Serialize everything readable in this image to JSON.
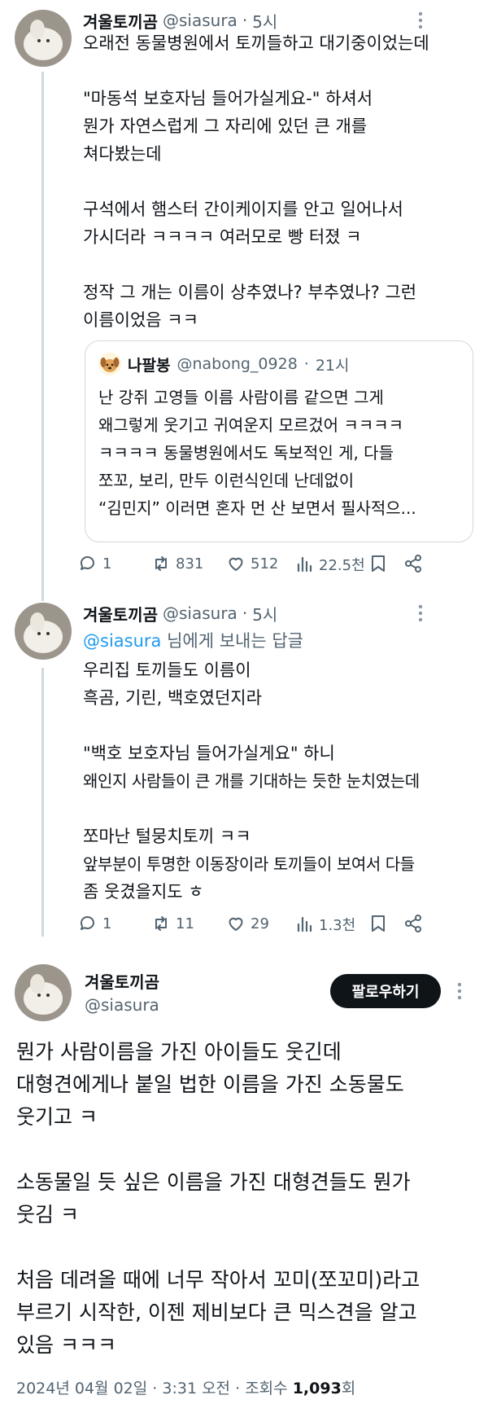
{
  "tweet1": {
    "name": "겨울토끼곰",
    "handle": "@siasura",
    "time": "5시",
    "lines": [
      "오래전 동물병원에서 토끼들하고 대기중이었는데",
      "",
      "\"마동석 보호자님 들어가실게요-\" 하셔서",
      "뭔가 자연스럽게 그 자리에 있던 큰 개를",
      "쳐다봤는데",
      "",
      "구석에서 햄스터 간이케이지를 안고 일어나서",
      "가시더라 ㅋㅋㅋㅋ 여러모로 빵 터졌 ㅋ",
      "",
      "정작 그 개는 이름이 상추였나? 부추였나? 그런",
      "이름이었음 ㅋㅋ"
    ],
    "quote": {
      "name": "나팔봉",
      "handle": "@nabong_0928",
      "time": "21시",
      "lines": [
        "난 강쥐 고영들 이름 사람이름 같으면 그게",
        "왜그렇게 웃기고 귀여운지 모르겄어 ㅋㅋㅋㅋ",
        "ㅋㅋㅋㅋ 동물병원에서도 독보적인 게, 다들",
        "쪼꼬, 보리, 만두 이런식인데 난데없이",
        "“김민지” 이러면 혼자 먼 산 보면서 필사적으..."
      ]
    },
    "actions": {
      "replies": "1",
      "retweets": "831",
      "likes": "512",
      "views": "22.5천"
    }
  },
  "tweet2": {
    "name": "겨울토끼곰",
    "handle": "@siasura",
    "time": "5시",
    "reply_to_mention": "@siasura",
    "reply_to_suffix": "님에게 보내는 답글",
    "lines": [
      "우리집 토끼들도 이름이",
      "흑곰, 기린, 백호였던지라",
      "",
      "\"백호 보호자님 들어가실게요\" 하니",
      "왜인지 사람들이 큰 개를 기대하는 듯한 눈치였는데",
      "",
      "쪼마난 털뭉치토끼 ㅋㅋ",
      "앞부분이 투명한 이동장이라 토끼들이 보여서 다들",
      "좀 웃겼을지도 ㅎ"
    ],
    "actions": {
      "replies": "1",
      "retweets": "11",
      "likes": "29",
      "views": "1.3천"
    }
  },
  "main": {
    "name": "겨울토끼곰",
    "handle": "@siasura",
    "follow_label": "팔로우하기",
    "lines": [
      "뭔가 사람이름을 가진 아이들도 웃긴데",
      "대형견에게나 붙일 법한 이름을 가진 소동물도",
      "웃기고 ㅋ",
      "",
      "소동물일 듯 싶은 이름을 가진 대형견들도 뭔가",
      "웃김 ㅋ",
      "",
      "처음 데려올 때에 너무 작아서 꼬미(쪼꼬미)라고",
      "부르기 시작한, 이젠 제비보다 큰 믹스견을 알고",
      "있음 ㅋㅋㅋ"
    ],
    "date": "2024년 04월 02일",
    "time": "3:31 오전",
    "views_label": "조회수",
    "views_count": "1,093",
    "views_suffix": "회"
  },
  "colors": {
    "text": "#0f1419",
    "secondary": "#536471",
    "accent": "#1d9bf0",
    "border": "#cfd9de"
  }
}
